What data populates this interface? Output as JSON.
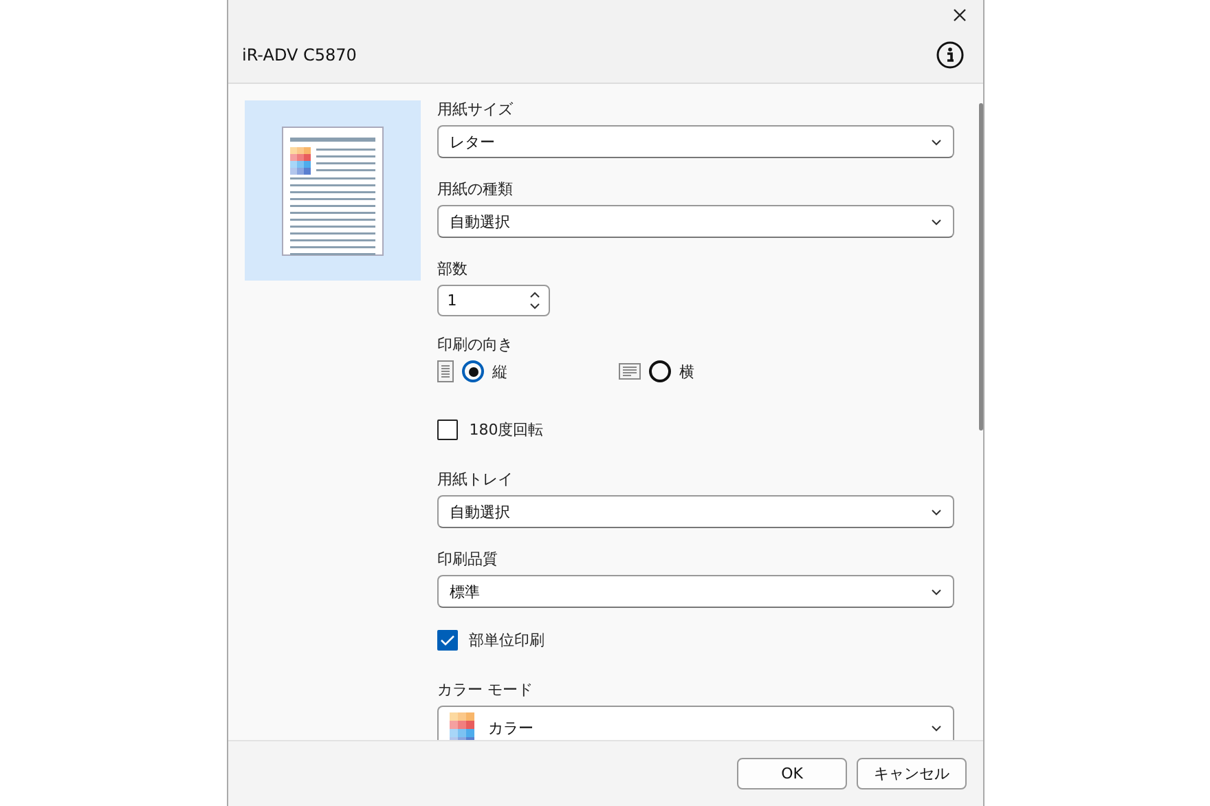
{
  "window": {
    "title": "iR-ADV C5870"
  },
  "settings": [
    {
      "kind": "dropdown",
      "label": "用紙サイズ",
      "value": "レター"
    },
    {
      "kind": "dropdown",
      "label": "用紙の種類",
      "value": "自動選択"
    },
    {
      "kind": "spinner",
      "label": "部数",
      "value": "1"
    },
    {
      "kind": "orientation",
      "label": "印刷の向き",
      "options": [
        {
          "kind": "portrait",
          "label": "縦",
          "selected": true
        },
        {
          "kind": "landscape",
          "label": "横",
          "selected": false
        }
      ]
    },
    {
      "kind": "checkbox",
      "label": "180度回転",
      "checked": false
    },
    {
      "kind": "dropdown",
      "label": "用紙トレイ",
      "value": "自動選択"
    },
    {
      "kind": "dropdown",
      "label": "印刷品質",
      "value": "標準"
    },
    {
      "kind": "checkbox",
      "label": "部単位印刷",
      "checked": true
    },
    {
      "kind": "color-dropdown",
      "label": "カラー モード",
      "value": "カラー"
    }
  ],
  "buttons": [
    "OK",
    "キャンセル"
  ]
}
